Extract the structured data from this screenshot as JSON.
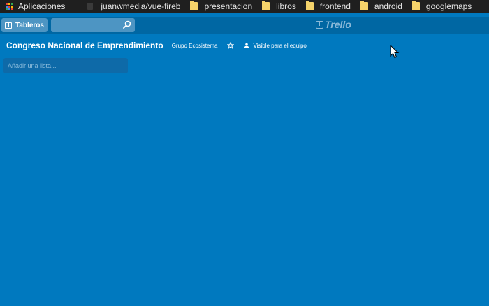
{
  "bookmarks": {
    "apps_label": "Aplicaciones",
    "items": [
      {
        "label": "juanwmedia/vue-fireb",
        "icon": "page-icon"
      },
      {
        "label": "presentacion",
        "icon": "folder-icon"
      },
      {
        "label": "libros",
        "icon": "folder-icon"
      },
      {
        "label": "frontend",
        "icon": "folder-icon"
      },
      {
        "label": "android",
        "icon": "folder-icon"
      },
      {
        "label": "googlemaps",
        "icon": "folder-icon"
      }
    ]
  },
  "header": {
    "boards_label": "Tableros",
    "search_value": "",
    "logo_text": "Trello"
  },
  "board": {
    "title": "Congreso Nacional de Emprendimiento",
    "team": "Grupo Ecosistema",
    "visibility": "Visible para el equipo",
    "add_list_placeholder": "Añadir una lista..."
  },
  "colors": {
    "board_background": "#0079bf",
    "header_background": "#0067a3",
    "bookmarks_background": "#1f1f1f",
    "folder": "#f4d26a"
  }
}
